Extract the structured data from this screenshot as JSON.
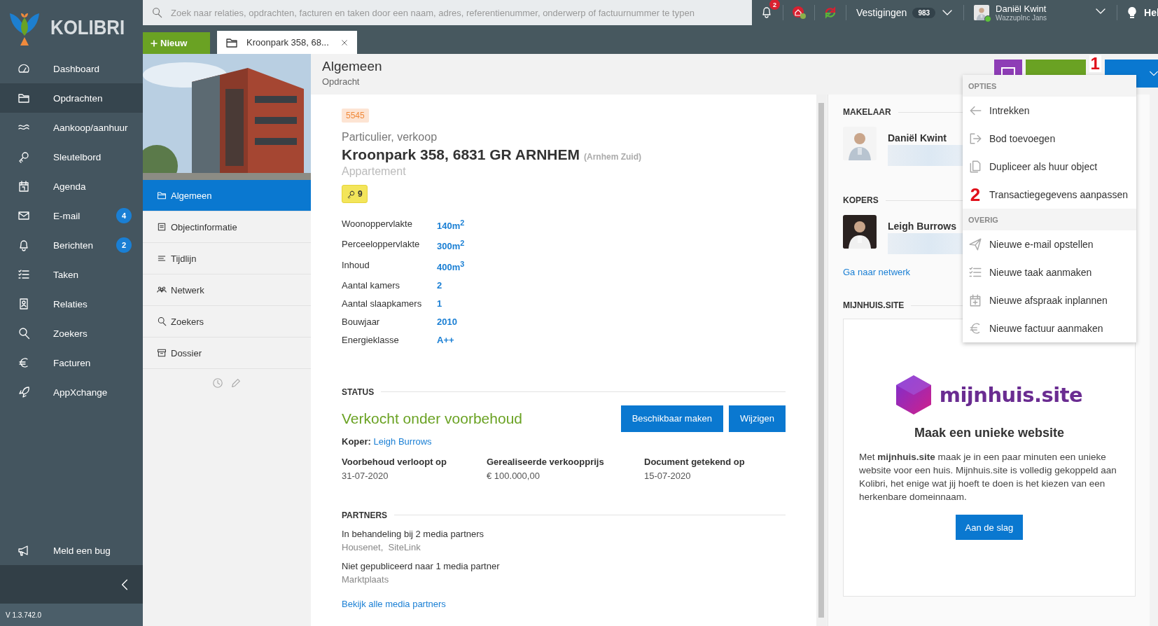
{
  "sidebar": {
    "logo_text": "KOLIBRI",
    "items": [
      {
        "label": "Dashboard",
        "selected": false
      },
      {
        "label": "Opdrachten",
        "selected": true
      },
      {
        "label": "Aankoop/aanhuur",
        "selected": false
      },
      {
        "label": "Sleutelbord",
        "selected": false
      },
      {
        "label": "Agenda",
        "selected": false
      },
      {
        "label": "E-mail",
        "selected": false,
        "badge": "4"
      },
      {
        "label": "Berichten",
        "selected": false,
        "badge": "2"
      },
      {
        "label": "Taken",
        "selected": false
      },
      {
        "label": "Relaties",
        "selected": false
      },
      {
        "label": "Zoekers",
        "selected": false
      },
      {
        "label": "Facturen",
        "selected": false
      },
      {
        "label": "AppXchange",
        "selected": false
      }
    ],
    "bug_report": "Meld een bug",
    "version": "V 1.3.742.0"
  },
  "topbar": {
    "search_placeholder": "Zoek naar relaties, opdrachten, facturen en taken door een naam, adres, referentienummer, onderwerp of factuurnummer te typen",
    "notifications_badge": "2",
    "branches_label": "Vestigingen",
    "branches_count": "983",
    "user": {
      "name": "Daniël Kwint",
      "organisation": "WazzupInc Jans",
      "online": true
    },
    "help": "Hel"
  },
  "tabbar": {
    "new_button": "Nieuw",
    "tabs": [
      {
        "label": "Kroonpark 358, 68...",
        "selected": true
      }
    ]
  },
  "subnav": [
    {
      "label": "Algemeen",
      "selected": true
    },
    {
      "label": "Objectinformatie",
      "selected": false
    },
    {
      "label": "Tijdlijn",
      "selected": false
    },
    {
      "label": "Netwerk",
      "selected": false
    },
    {
      "label": "Zoekers",
      "selected": false
    },
    {
      "label": "Dossier",
      "selected": false
    }
  ],
  "header": {
    "title": "Algemeen",
    "subtitle": "Opdracht",
    "annotation": "1",
    "buttons": [
      {
        "kind": "icon"
      },
      {
        "kind": "edit"
      },
      {
        "kind": "dropdown"
      }
    ]
  },
  "object": {
    "id": "5545",
    "category": "Particulier, verkoop",
    "address": "Kroonpark 358, 6831 GR ARNHEM",
    "district": "(Arnhem Zuid)",
    "type": "Appartement",
    "keys": "9",
    "specs": [
      {
        "label": "Woonoppervlakte",
        "value": "140m$^{2}$"
      },
      {
        "label": "Perceeloppervlakte",
        "value": "300m$^{2}$"
      },
      {
        "label": "Inhoud",
        "value": "400m$^{3}$"
      },
      {
        "label": "Aantal kamers",
        "value": "2"
      },
      {
        "label": "Aantal slaapkamers",
        "value": "1"
      },
      {
        "label": "Bouwjaar",
        "value": "2010"
      },
      {
        "label": "Energieklasse",
        "value": "A++"
      }
    ]
  },
  "status": {
    "heading": "STATUS",
    "value": "Verkocht onder voorbehoud",
    "buttons": [
      "Beschikbaar maken",
      "Wijzigen"
    ],
    "buyer_label": "Koper:",
    "buyer": "Leigh Burrows",
    "facts": [
      {
        "label": "Voorbehoud verloopt op",
        "value": "31-07-2020"
      },
      {
        "label": "Gerealiseerde verkoopprijs",
        "value": "€ 100.000,00"
      },
      {
        "label": "Document getekend op",
        "value": "15-07-2020"
      }
    ]
  },
  "partners": {
    "heading": "PARTNERS",
    "groups": [
      {
        "title": "In behandeling bij 2 media partners",
        "names": "Housenet,  SiteLink"
      },
      {
        "title": "Niet gepubliceerd naar 1 media partner",
        "names": "Marktplaats"
      }
    ],
    "link": "Bekijk alle media partners"
  },
  "right_panel": {
    "agent": {
      "heading": "MAKELAAR",
      "name": "Daniël Kwint"
    },
    "buyers": {
      "heading": "KOPERS",
      "name": "Leigh Burrows",
      "link": "Ga naar netwerk"
    },
    "promo": {
      "heading": "MIJNHUIS.SITE",
      "logo_text": "mijnhuis.site",
      "title": "Maak een unieke website",
      "text": "Met **mijnhuis.site** maak je in een paar minuten een unieke website voor een huis. Mijnhuis.site is volledig gekoppeld aan Kolibri, het enige wat jij hoeft te doen is het kiezen van een herkenbare domeinnaam.",
      "button": "Aan de slag"
    }
  },
  "options_menu": {
    "sections": [
      {
        "heading": "OPTIES",
        "items": [
          {
            "label": "Intrekken"
          },
          {
            "label": "Bod toevoegen"
          },
          {
            "label": "Dupliceer als huur object"
          },
          {
            "label": "Transactiegegevens aanpassen",
            "annotation": "2"
          }
        ]
      },
      {
        "heading": "OVERIG",
        "items": [
          {
            "label": "Nieuwe e-mail opstellen"
          },
          {
            "label": "Nieuwe taak aanmaken"
          },
          {
            "label": "Nieuwe afspraak inplannen"
          },
          {
            "label": "Nieuwe factuur aanmaken"
          }
        ]
      }
    ]
  }
}
